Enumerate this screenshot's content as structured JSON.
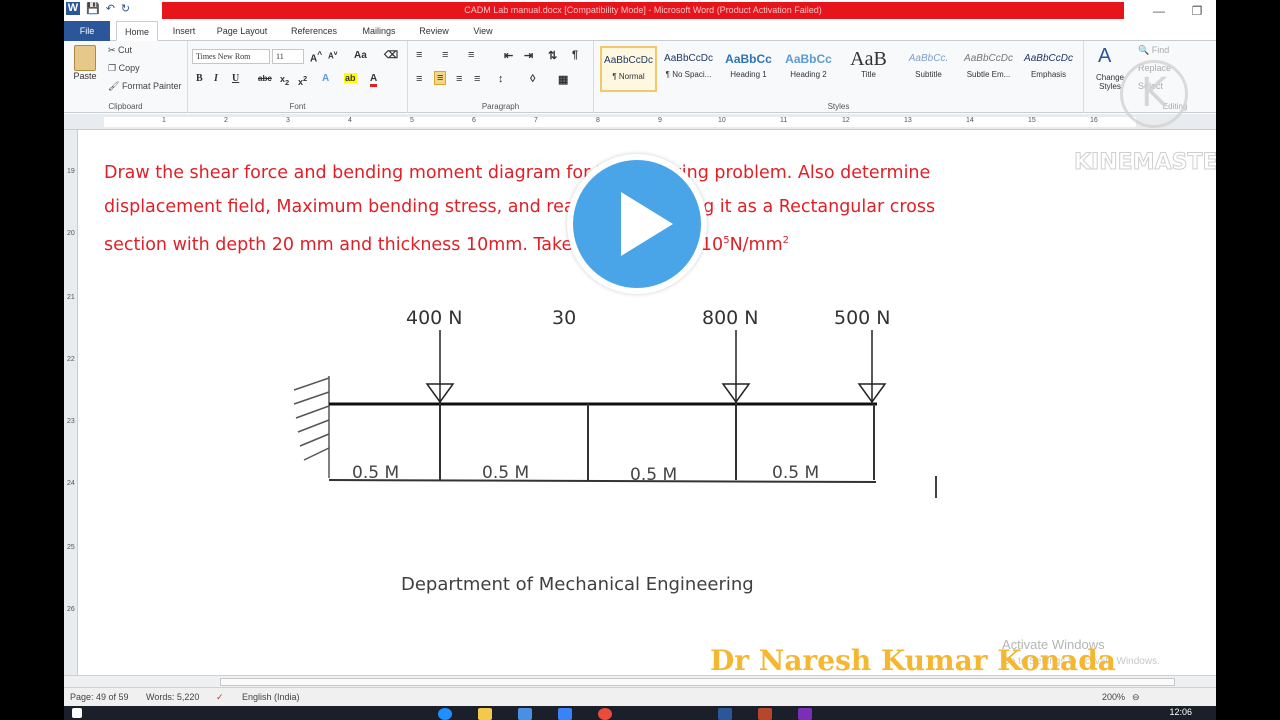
{
  "window": {
    "title_bar_text": "CADM Lab manual.docx [Compatibility Mode] - Microsoft Word (Product Activation Failed)"
  },
  "ribbon_tabs": [
    "File",
    "Home",
    "Insert",
    "Page Layout",
    "References",
    "Mailings",
    "Review",
    "View"
  ],
  "clipboard": {
    "paste": "Paste",
    "cut": "Cut",
    "copy": "Copy",
    "format_painter": "Format Painter",
    "group_label": "Clipboard"
  },
  "font": {
    "family": "Times New Rom",
    "size": "11",
    "group_label": "Font"
  },
  "paragraph": {
    "group_label": "Paragraph"
  },
  "styles": {
    "group_label": "Styles",
    "items": [
      {
        "preview": "AaBbCcDc",
        "label": "¶ Normal"
      },
      {
        "preview": "AaBbCcDc",
        "label": "¶ No Spaci..."
      },
      {
        "preview": "AaBbCc",
        "label": "Heading 1"
      },
      {
        "preview": "AaBbCc",
        "label": "Heading 2"
      },
      {
        "preview": "AaB",
        "label": "Title"
      },
      {
        "preview": "AaBbCc.",
        "label": "Subtitle"
      },
      {
        "preview": "AaBbCcDc",
        "label": "Subtle Em..."
      },
      {
        "preview": "AaBbCcDc",
        "label": "Emphasis"
      }
    ],
    "change_styles": "Change Styles"
  },
  "editing": {
    "find": "Find",
    "replace": "Replace",
    "select": "Select",
    "group_label": "Editing"
  },
  "document": {
    "question_line1": "Draw the shear force and bending moment diagram for the following problem. Also determine",
    "question_line2": "displacement field, Maximum bending stress, and reactions by taking it as a Rectangular cross",
    "question_line3_prefix": "section with depth 20 mm and thickness 10mm. Take μ= 0.3, E= 2x10",
    "question_exp": "5",
    "question_unit": "N/mm",
    "question_unit_exp": "2",
    "loads": [
      "400 N",
      "30",
      "800 N",
      "500 N"
    ],
    "spans": [
      "0.5 M",
      "0.5 M",
      "0.5 M",
      "0.5 M"
    ],
    "footer_dept": "Department of Mechanical Engineering"
  },
  "overlay": {
    "watermark": "KINEMASTER",
    "watermark_logo": "K",
    "activate_windows": "Activate Windows",
    "activate_sub": "Go to Settings to activate Windows.",
    "author": "Dr Naresh Kumar Konada"
  },
  "status": {
    "page": "Page: 49 of 59",
    "words": "Words: 5,220",
    "language": "English (India)",
    "zoom": "200%"
  },
  "taskbar": {
    "time": "12:06"
  }
}
